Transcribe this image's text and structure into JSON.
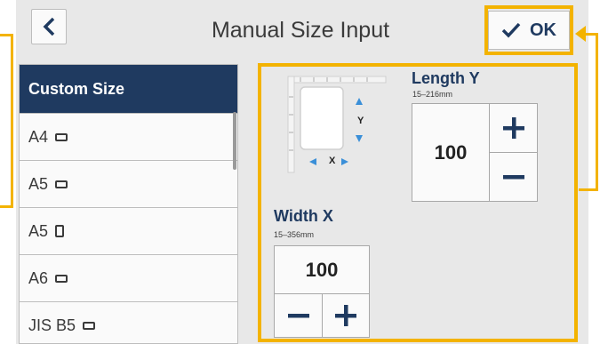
{
  "header": {
    "title": "Manual Size Input",
    "ok_label": "OK"
  },
  "list": {
    "items": [
      {
        "label": "Custom Size",
        "icon": ""
      },
      {
        "label": "A4",
        "icon": "landscape-icon"
      },
      {
        "label": "A5",
        "icon": "landscape-icon"
      },
      {
        "label": "A5",
        "icon": "portrait-icon"
      },
      {
        "label": "A6",
        "icon": "landscape-icon"
      },
      {
        "label": "JIS B5",
        "icon": "landscape-icon"
      }
    ]
  },
  "length_y": {
    "label": "Length Y",
    "range": "15–216mm",
    "value": "100"
  },
  "width_x": {
    "label": "Width X",
    "range": "15–356mm",
    "value": "100"
  },
  "diagram": {
    "x_label": "X",
    "y_label": "Y"
  },
  "colors": {
    "accent": "#1f3a60",
    "highlight": "#f3b300",
    "arrow": "#3a8fd8"
  }
}
